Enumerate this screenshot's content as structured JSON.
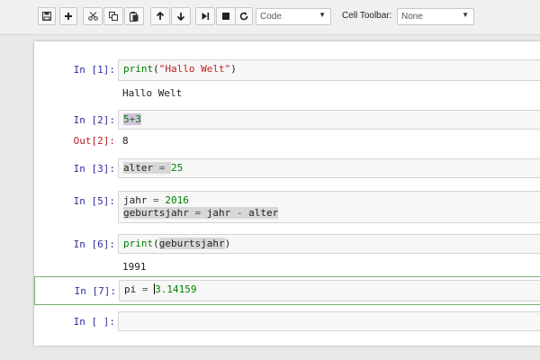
{
  "toolbar": {
    "cell_type_value": "Code",
    "cell_toolbar_label": "Cell Toolbar:",
    "cell_toolbar_value": "None"
  },
  "cells": [
    {
      "prompt": "In [1]:",
      "code": [
        "print(\"Hallo Welt\")"
      ],
      "output": "Hallo Welt"
    },
    {
      "prompt": "In [2]:",
      "code": [
        "5+3"
      ],
      "out_prompt": "Out[2]:",
      "output": "8"
    },
    {
      "prompt": "In [3]:",
      "code": [
        "alter = 25"
      ]
    },
    {
      "prompt": "In [5]:",
      "code": [
        "jahr = 2016",
        "geburtsjahr = jahr - alter"
      ]
    },
    {
      "prompt": "In [6]:",
      "code": [
        "print(geburtsjahr)"
      ],
      "output": "1991"
    },
    {
      "prompt": "In [7]:",
      "code": [
        "pi = 3.14159"
      ]
    },
    {
      "prompt": "In [ ]:",
      "code": [
        ""
      ]
    }
  ],
  "colors": {
    "prompt_in": "#30309e",
    "prompt_out": "#b62222",
    "selected_border": "#76b36a",
    "keyword": "#008000",
    "string": "#ba2121"
  }
}
